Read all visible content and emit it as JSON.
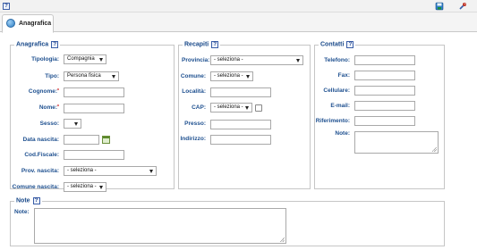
{
  "toolbar": {
    "help_label": "?",
    "icons": [
      "save-icon",
      "tools-icon"
    ]
  },
  "tabs": [
    {
      "label": "Anagrafica",
      "icon": "user-circle-icon"
    }
  ],
  "anagrafica": {
    "legend": "Anagrafica",
    "help": "?",
    "tipologia": {
      "label": "Tipologia:",
      "value": "Compagnia"
    },
    "tipo": {
      "label": "Tipo:",
      "value": "Persona fisica"
    },
    "cognome": {
      "label": "Cognome:",
      "required": "*",
      "value": ""
    },
    "nome": {
      "label": "Nome:",
      "required": "*",
      "value": ""
    },
    "sesso": {
      "label": "Sesso:",
      "value": ""
    },
    "data_nascita": {
      "label": "Data nascita:",
      "value": ""
    },
    "cod_fiscale": {
      "label": "Cod.Fiscale:",
      "value": ""
    },
    "prov_nascita": {
      "label": "Prov. nascita:",
      "value": "- seleziona -"
    },
    "comune_nascita": {
      "label": "Comune nascita:",
      "value": "- seleziona -"
    }
  },
  "recapiti": {
    "legend": "Recapiti",
    "help": "?",
    "provincia": {
      "label": "Provincia:",
      "value": "- seleziona -"
    },
    "comune": {
      "label": "Comune:",
      "value": "- seleziona -"
    },
    "localita": {
      "label": "Località:",
      "value": ""
    },
    "cap": {
      "label": "CAP:",
      "value": "- seleziona -"
    },
    "presso": {
      "label": "Presso:",
      "value": ""
    },
    "indirizzo": {
      "label": "Indirizzo:",
      "value": ""
    }
  },
  "contatti": {
    "legend": "Contatti",
    "help": "?",
    "telefono": {
      "label": "Telefono:",
      "value": ""
    },
    "fax": {
      "label": "Fax:",
      "value": ""
    },
    "cellulare": {
      "label": "Cellulare:",
      "value": ""
    },
    "email": {
      "label": "E-mail:",
      "value": ""
    },
    "riferimento": {
      "label": "Riferimento:",
      "value": ""
    },
    "note": {
      "label": "Note:",
      "value": ""
    }
  },
  "note_section": {
    "legend": "Note",
    "help": "?",
    "note": {
      "label": "Note:",
      "value": ""
    }
  },
  "colors": {
    "label_blue": "#1d4f8f",
    "legend_blue": "#1a4a8a",
    "border": "#c6c6c6",
    "required_red": "#cc0000"
  }
}
